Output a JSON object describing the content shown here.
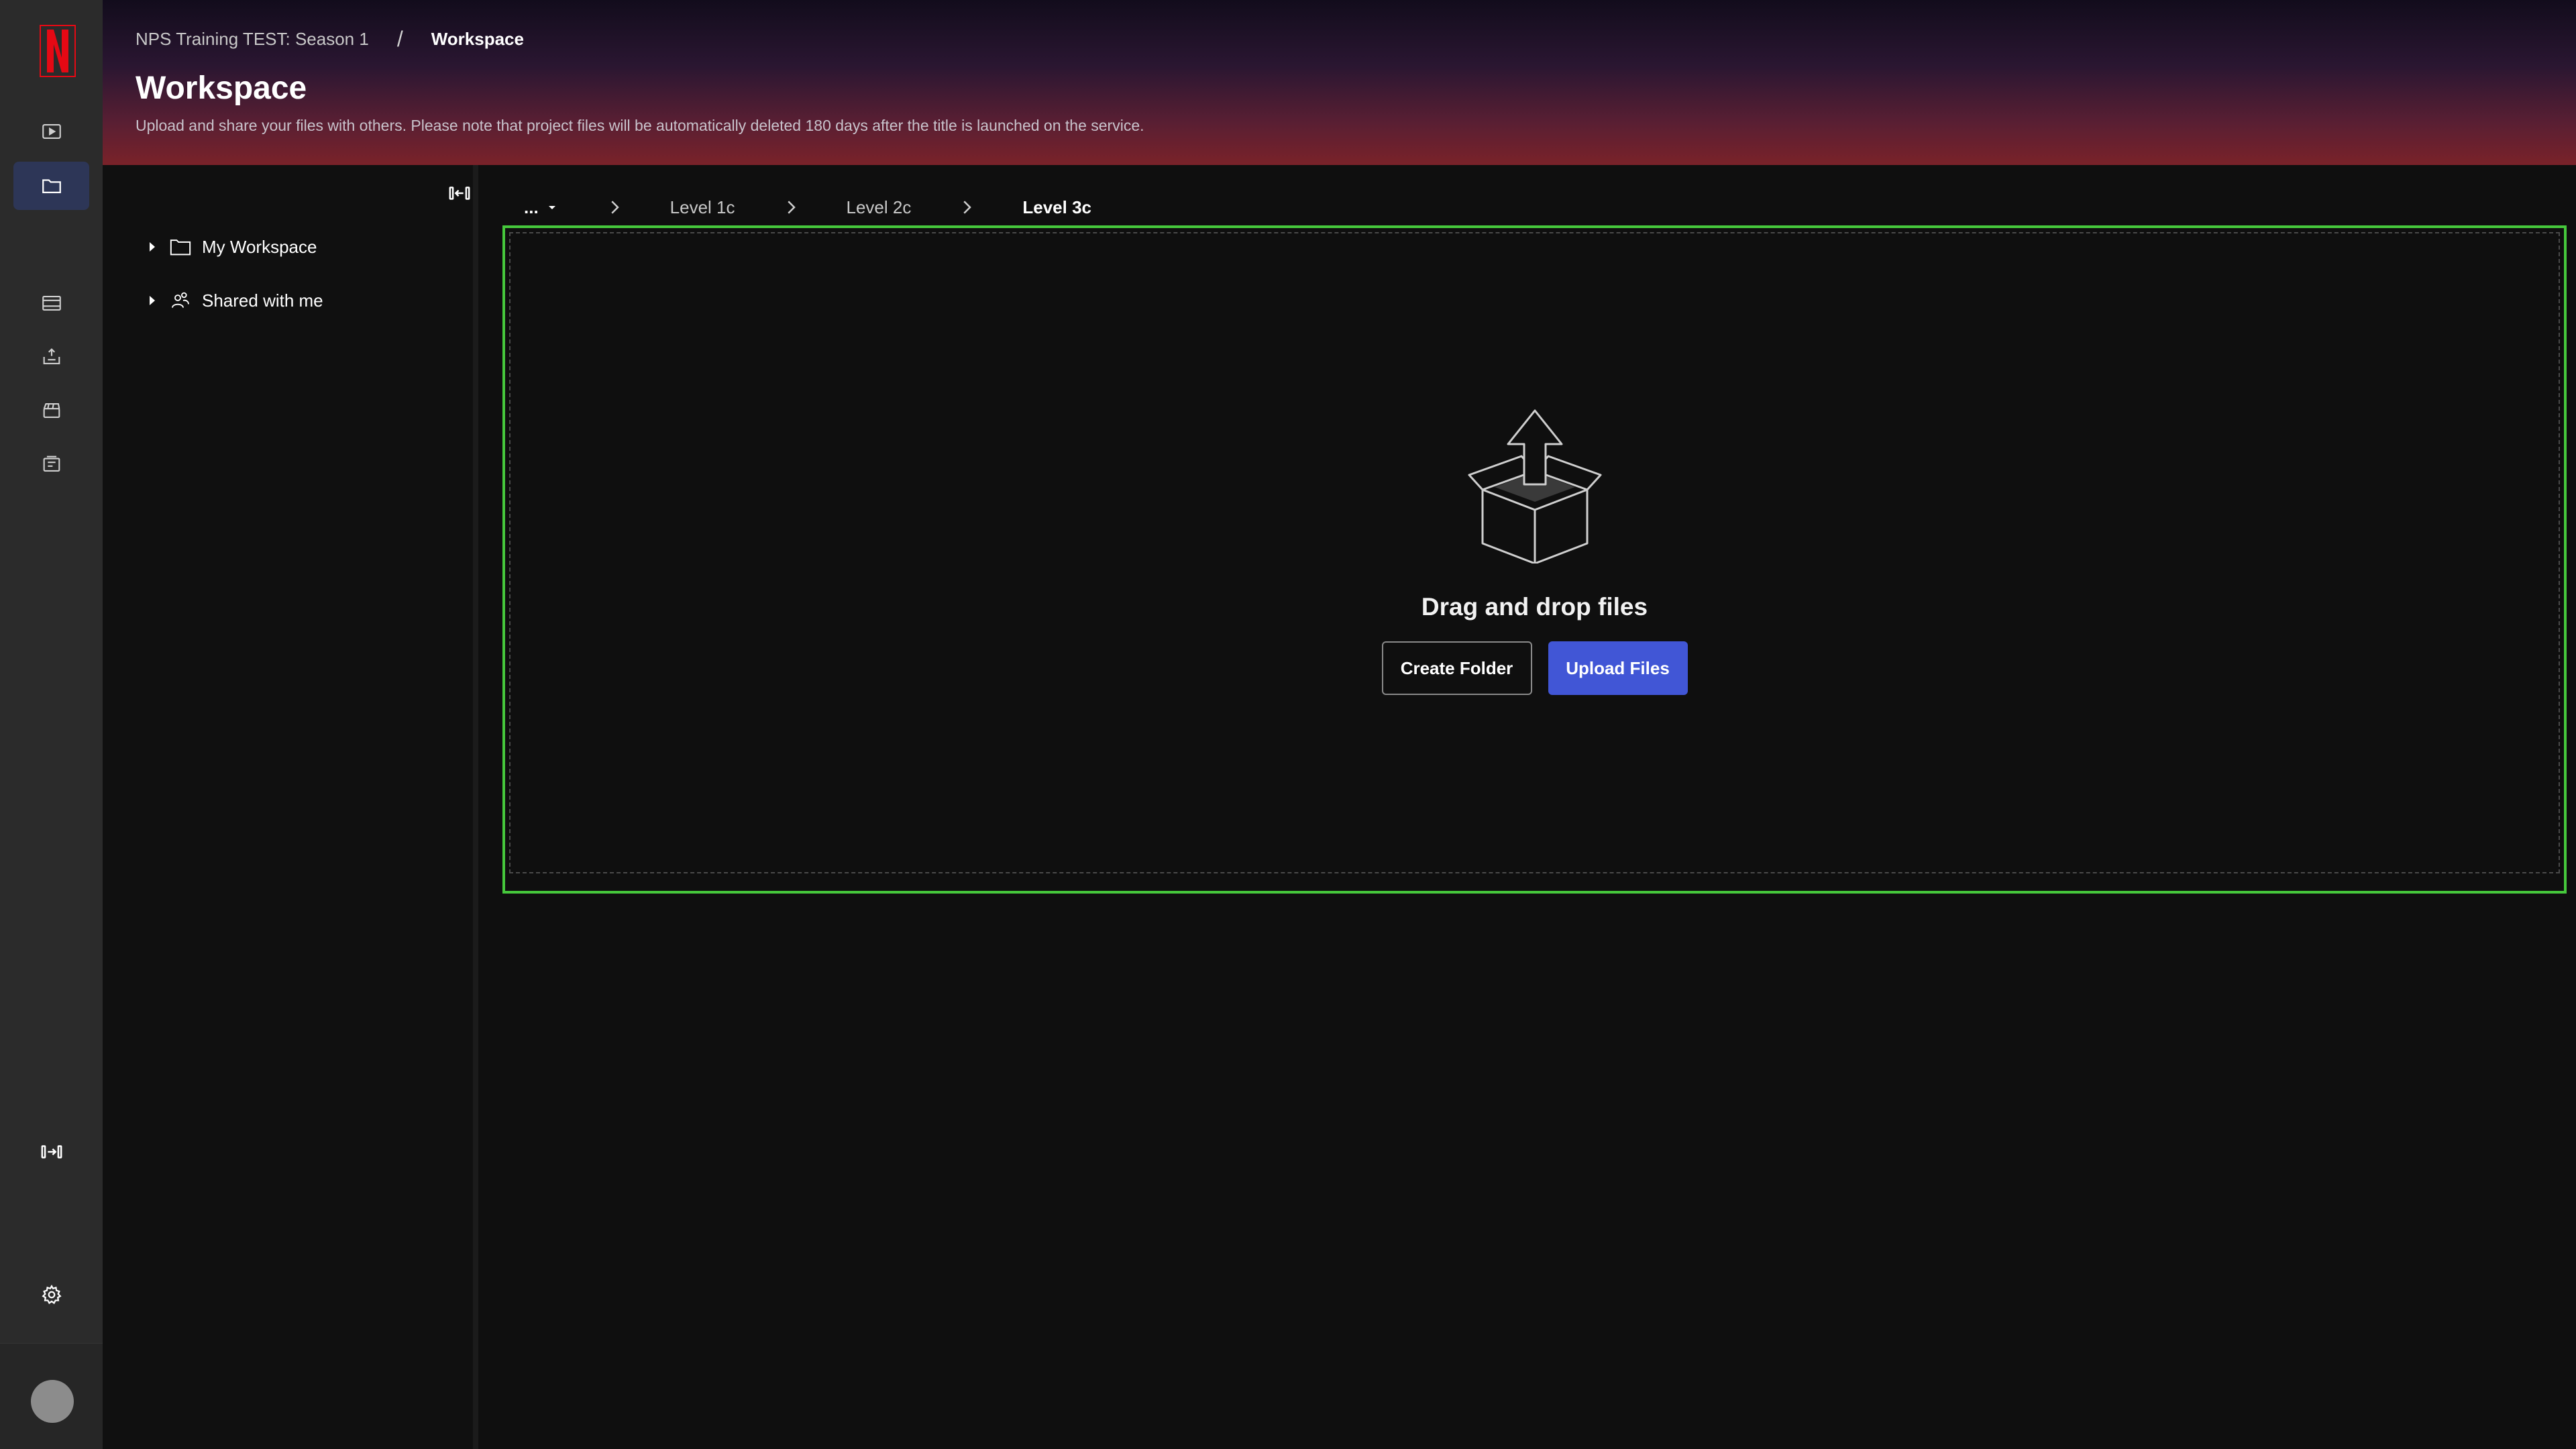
{
  "app": {
    "brand_letter": "N",
    "brand_color": "#e50914",
    "accent_color": "#4156d6",
    "dropzone_border_color": "#46c83c"
  },
  "rail": {
    "items": [
      {
        "icon": "play-icon",
        "active": false
      },
      {
        "icon": "folder-icon",
        "active": true
      },
      {
        "icon": "film-strip-icon",
        "active": false
      },
      {
        "icon": "upload-tray-icon",
        "active": false
      },
      {
        "icon": "clapperboard-icon",
        "active": false
      },
      {
        "icon": "inbox-list-icon",
        "active": false
      }
    ],
    "expand_icon": "expand-sidebar-icon",
    "settings_icon": "gear-icon",
    "avatar_icon": "avatar"
  },
  "header": {
    "breadcrumb_parent": "NPS Training TEST: Season 1",
    "breadcrumb_separator": "/",
    "breadcrumb_current": "Workspace",
    "title": "Workspace",
    "subtitle": "Upload and share your files with others. Please note that project files will be automatically deleted 180 days after the title is launched on the service."
  },
  "tree": {
    "collapse_icon": "collapse-panel-icon",
    "items": [
      {
        "label": "My Workspace",
        "icon": "folder-icon"
      },
      {
        "label": "Shared with me",
        "icon": "shared-users-icon"
      }
    ]
  },
  "path": {
    "ellipsis": "...",
    "levels": [
      "Level 1c",
      "Level 2c",
      "Level 3c"
    ]
  },
  "dropzone": {
    "icon": "open-box-upload-icon",
    "title": "Drag and drop files",
    "create_folder_label": "Create Folder",
    "upload_files_label": "Upload Files"
  }
}
